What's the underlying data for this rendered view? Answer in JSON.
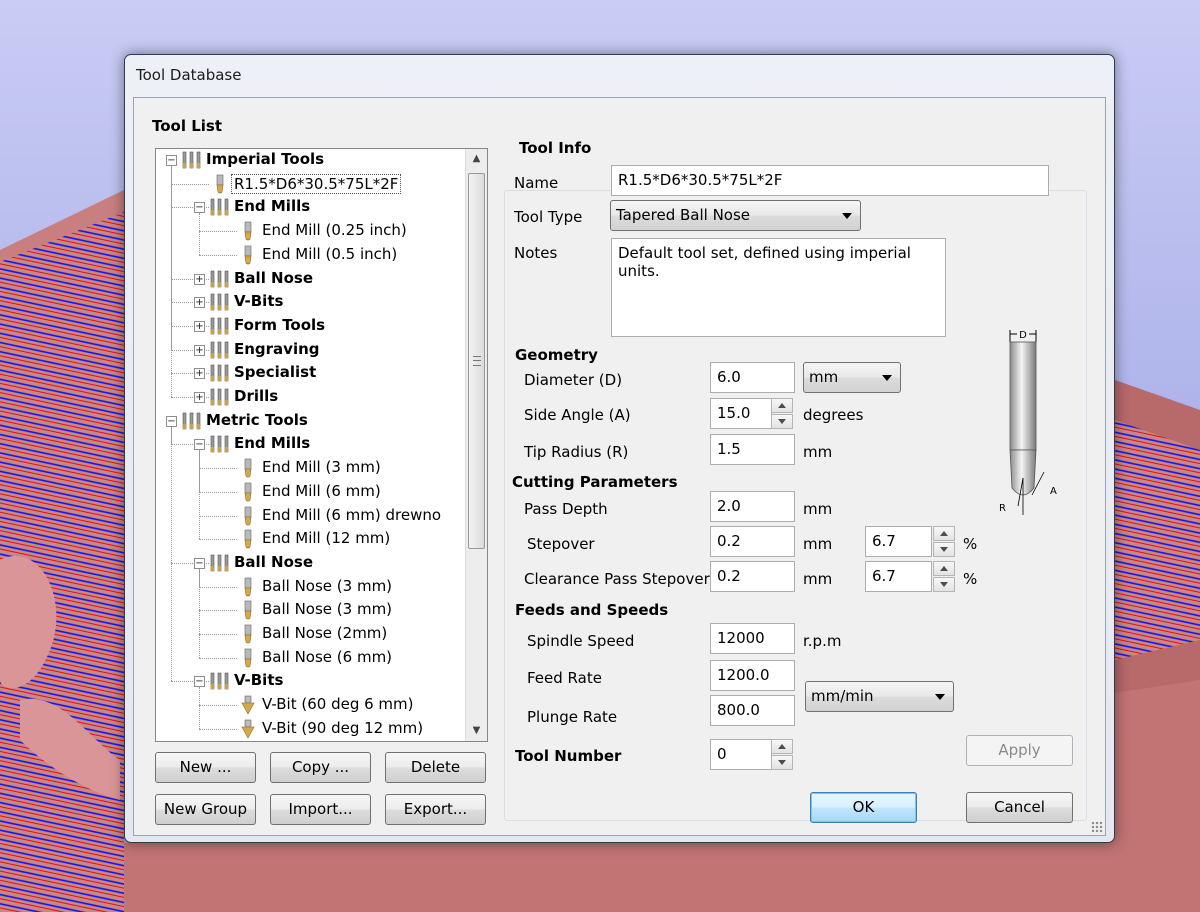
{
  "window": {
    "title": "Tool Database"
  },
  "tool_list": {
    "title": "Tool List",
    "rows": [
      {
        "label": "Imperial Tools",
        "level": 0,
        "kind": "group",
        "toggle": "−"
      },
      {
        "label": "R1.5*D6*30.5*75L*2F",
        "level": 1,
        "kind": "tool",
        "selected": true,
        "icon": "tapered-ball-nose"
      },
      {
        "label": "End Mills",
        "level": 1,
        "kind": "group",
        "toggle": "−"
      },
      {
        "label": "End Mill (0.25 inch)",
        "level": 2,
        "kind": "tool",
        "icon": "end-mill"
      },
      {
        "label": "End Mill (0.5 inch)",
        "level": 2,
        "kind": "tool",
        "icon": "end-mill"
      },
      {
        "label": "Ball Nose",
        "level": 1,
        "kind": "group",
        "toggle": "+"
      },
      {
        "label": "V-Bits",
        "level": 1,
        "kind": "group",
        "toggle": "+"
      },
      {
        "label": "Form Tools",
        "level": 1,
        "kind": "group",
        "toggle": "+"
      },
      {
        "label": "Engraving",
        "level": 1,
        "kind": "group",
        "toggle": "+"
      },
      {
        "label": "Specialist",
        "level": 1,
        "kind": "group",
        "toggle": "+"
      },
      {
        "label": "Drills",
        "level": 1,
        "kind": "group",
        "toggle": "+"
      },
      {
        "label": "Metric Tools",
        "level": 0,
        "kind": "group",
        "toggle": "−"
      },
      {
        "label": "End Mills",
        "level": 1,
        "kind": "group",
        "toggle": "−"
      },
      {
        "label": "End Mill (3 mm)",
        "level": 2,
        "kind": "tool",
        "icon": "end-mill"
      },
      {
        "label": "End Mill (6 mm)",
        "level": 2,
        "kind": "tool",
        "icon": "end-mill"
      },
      {
        "label": "End Mill (6 mm) drewno",
        "level": 2,
        "kind": "tool",
        "icon": "end-mill"
      },
      {
        "label": "End Mill (12 mm)",
        "level": 2,
        "kind": "tool",
        "icon": "end-mill"
      },
      {
        "label": "Ball Nose",
        "level": 1,
        "kind": "group",
        "toggle": "−"
      },
      {
        "label": "Ball Nose (3 mm)",
        "level": 2,
        "kind": "tool",
        "icon": "ball-nose"
      },
      {
        "label": "Ball Nose (3 mm)",
        "level": 2,
        "kind": "tool",
        "icon": "ball-nose"
      },
      {
        "label": "Ball Nose (2mm)",
        "level": 2,
        "kind": "tool",
        "icon": "ball-nose"
      },
      {
        "label": "Ball Nose (6 mm)",
        "level": 2,
        "kind": "tool",
        "icon": "ball-nose"
      },
      {
        "label": "V-Bits",
        "level": 1,
        "kind": "group",
        "toggle": "−"
      },
      {
        "label": "V-Bit (60 deg 6 mm)",
        "level": 2,
        "kind": "tool",
        "icon": "v-bit"
      },
      {
        "label": "V-Bit (90 deg 12 mm)",
        "level": 2,
        "kind": "tool",
        "icon": "v-bit"
      }
    ],
    "buttons": {
      "new": "New ...",
      "copy": "Copy ...",
      "delete": "Delete",
      "new_group": "New Group",
      "import": "Import...",
      "export": "Export..."
    }
  },
  "tool_info": {
    "title": "Tool Info",
    "name_label": "Name",
    "name_value": "R1.5*D6*30.5*75L*2F",
    "tool_type_label": "Tool Type",
    "tool_type_value": "Tapered Ball Nose",
    "notes_label": "Notes",
    "notes_value": "Default tool set, defined using imperial units."
  },
  "geometry": {
    "title": "Geometry",
    "diameter_label": "Diameter (D)",
    "diameter_value": "6.0",
    "units_value": "mm",
    "side_angle_label": "Side Angle (A)",
    "side_angle_value": "15.0",
    "side_angle_unit": "degrees",
    "tip_radius_label": "Tip Radius (R)",
    "tip_radius_value": "1.5",
    "tip_radius_unit": "mm"
  },
  "diagram": {
    "d_label": "D",
    "a_label": "A",
    "r_label": "R"
  },
  "cutting": {
    "title": "Cutting Parameters",
    "pass_depth_label": "Pass Depth",
    "pass_depth_value": "2.0",
    "pass_depth_unit": "mm",
    "stepover_label": "Stepover",
    "stepover_value": "0.2",
    "stepover_unit": "mm",
    "stepover_percent": "6.7",
    "clearance_label": "Clearance Pass Stepover",
    "clearance_value": "0.2",
    "clearance_unit": "mm",
    "clearance_percent": "6.7",
    "percent_sign": "%"
  },
  "feeds": {
    "title": "Feeds and Speeds",
    "spindle_label": "Spindle Speed",
    "spindle_value": "12000",
    "spindle_unit": "r.p.m",
    "feed_rate_label": "Feed Rate",
    "feed_rate_value": "1200.0",
    "rate_units_value": "mm/min",
    "plunge_rate_label": "Plunge Rate",
    "plunge_rate_value": "800.0"
  },
  "tool_number": {
    "label": "Tool Number",
    "value": "0"
  },
  "footer": {
    "apply": "Apply",
    "ok": "OK",
    "cancel": "Cancel"
  },
  "colors": {
    "toolpath_blue": "#1212e6",
    "toolpath_red": "#e01010",
    "stock": "#c9797a",
    "accent": "#3c7fb1"
  }
}
